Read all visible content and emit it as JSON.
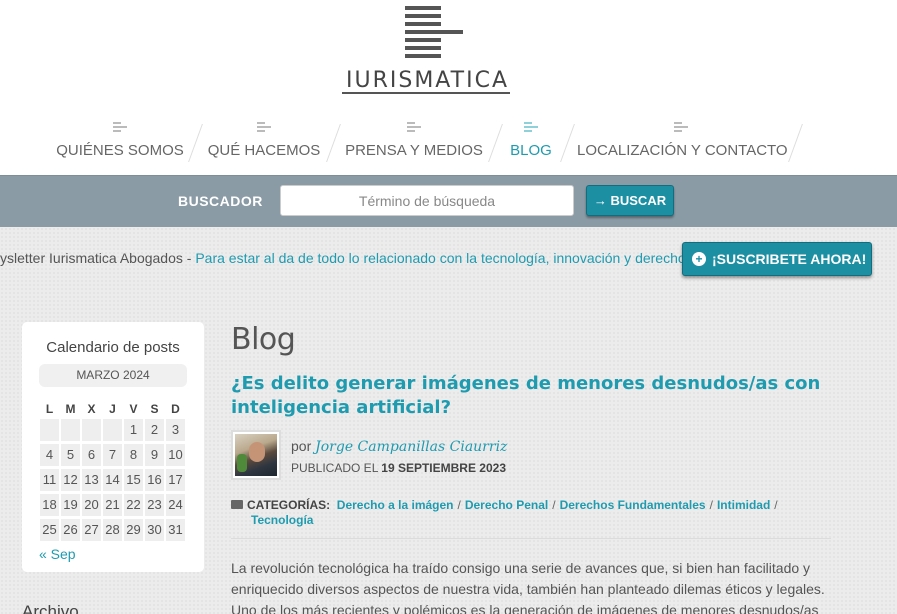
{
  "brand": {
    "name": "IURISMATICA"
  },
  "nav": {
    "items": [
      {
        "label": "QUIÉNES SOMOS"
      },
      {
        "label": "QUÉ HACEMOS"
      },
      {
        "label": "PRENSA Y MEDIOS"
      },
      {
        "label": "BLOG",
        "active": true
      },
      {
        "label": "LOCALIZACIÓN Y CONTACTO"
      }
    ]
  },
  "search": {
    "label": "BUSCADOR",
    "placeholder": "Término de búsqueda",
    "button": "→ BUSCAR"
  },
  "newsletter": {
    "lead": "ysletter Iurismatica Abogados",
    "separator": " - ",
    "link": "Para estar al da de todo lo relacionado con la tecnología, innovación y derecho",
    "button": "¡SUSCRIBETE AHORA!",
    "button_icon": "plus-circle-icon"
  },
  "calendar": {
    "title": "Calendario de posts",
    "month": "MARZO 2024",
    "weekdays": [
      "L",
      "M",
      "X",
      "J",
      "V",
      "S",
      "D"
    ],
    "weeks": [
      [
        "",
        "",
        "",
        "",
        "1",
        "2",
        "3"
      ],
      [
        "4",
        "5",
        "6",
        "7",
        "8",
        "9",
        "10"
      ],
      [
        "11",
        "12",
        "13",
        "14",
        "15",
        "16",
        "17"
      ],
      [
        "18",
        "19",
        "20",
        "21",
        "22",
        "23",
        "24"
      ],
      [
        "25",
        "26",
        "27",
        "28",
        "29",
        "30",
        "31"
      ]
    ],
    "prev": "« Sep"
  },
  "sidebar": {
    "archive_title": "Archivo"
  },
  "main": {
    "section_title": "Blog",
    "post": {
      "title": "¿Es delito generar imágenes de menores desnudos/as con inteligencia artificial?",
      "by": "por",
      "author": "Jorge Campanillas Ciaurriz",
      "published_label": "PUBLICADO EL",
      "published_date": "19 SEPTIEMBRE 2023",
      "categories_label": "CATEGORÍAS:",
      "categories": [
        "Derecho a la imágen",
        "Derecho Penal",
        "Derechos Fundamentales",
        "Intimidad",
        "Tecnología"
      ],
      "body": "La revolución tecnológica ha traído consigo una serie de avances que, si bien han facilitado y enriquecido diversos aspectos de nuestra vida, también han planteado dilemas éticos y legales. Uno de los más recientes y polémicos es la generación de imágenes de menores desnudos/as"
    }
  },
  "colors": {
    "accent": "#1f9bb0",
    "search_band": "#8a9ba6",
    "button": "#1d8fa3"
  }
}
